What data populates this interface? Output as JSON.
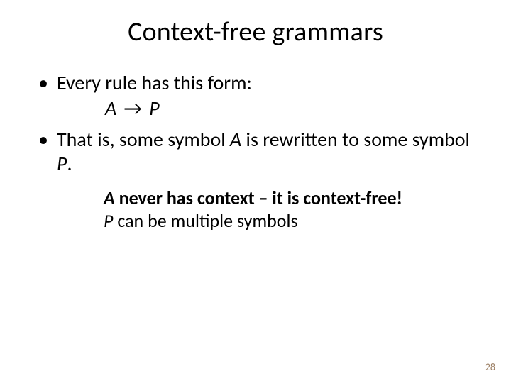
{
  "title": "Context-free grammars",
  "bullets": {
    "b1": "Every rule has this form:",
    "rule_A": "A",
    "rule_arrow": "→",
    "rule_P": "P",
    "b2_pre": "That is, some symbol ",
    "b2_A": "A",
    "b2_mid": " is rewritten to some symbol ",
    "b2_P": "P",
    "b2_post": "."
  },
  "sub": {
    "l1_A": "A",
    "l1_rest": " never has context – it is context-free!",
    "l2_P": "P",
    "l2_rest": " can be multiple symbols"
  },
  "page": "28"
}
